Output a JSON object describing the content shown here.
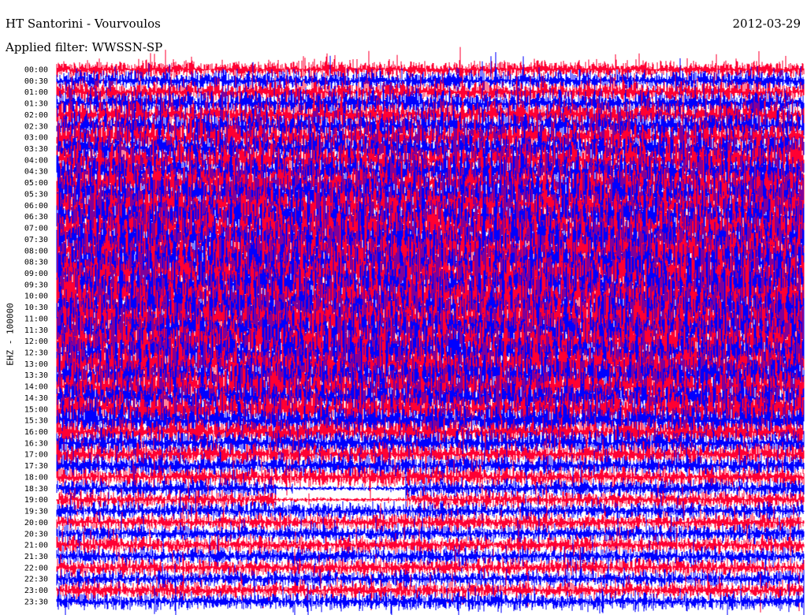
{
  "header": {
    "station": "HT Santorini - Vourvoulos",
    "filter": "Applied filter: WWSSN-SP",
    "date": "2012-03-29"
  },
  "chart_data": {
    "type": "line",
    "title": "HT Santorini - Vourvoulos",
    "subtitle": "Applied filter: WWSSN-SP",
    "date": "2012-03-29",
    "ylabel": "EHZ - 100000",
    "xlabel": "",
    "tick_labels": [
      "00:00",
      "00:30",
      "01:00",
      "01:30",
      "02:00",
      "02:30",
      "03:00",
      "03:30",
      "04:00",
      "04:30",
      "05:00",
      "05:30",
      "06:00",
      "06:30",
      "07:00",
      "07:30",
      "08:00",
      "08:30",
      "09:00",
      "09:30",
      "10:00",
      "10:30",
      "11:00",
      "11:30",
      "12:00",
      "12:30",
      "13:00",
      "13:30",
      "14:00",
      "14:30",
      "15:00",
      "15:30",
      "16:00",
      "16:30",
      "17:00",
      "17:30",
      "18:00",
      "18:30",
      "19:00",
      "19:30",
      "20:00",
      "20:30",
      "21:00",
      "21:30",
      "22:00",
      "22:30",
      "23:00",
      "23:30"
    ],
    "grid": false,
    "series": [
      {
        "color": "#ff0033"
      },
      {
        "color": "#0000ff"
      }
    ]
  }
}
